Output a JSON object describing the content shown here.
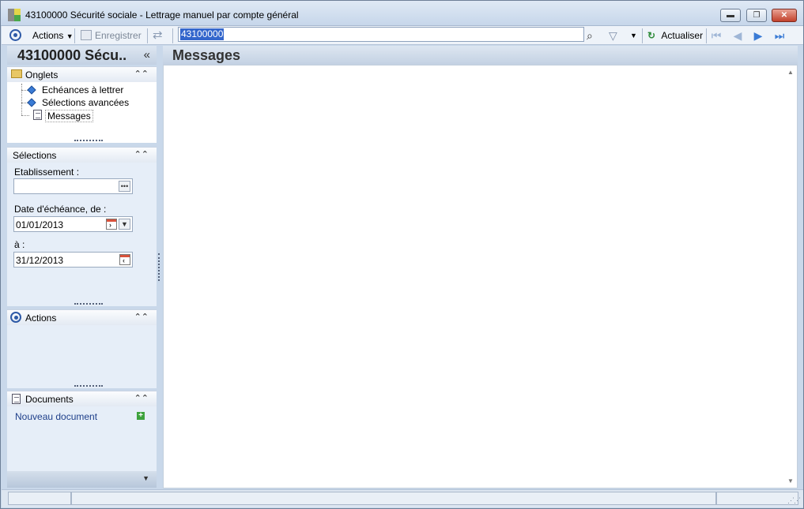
{
  "window": {
    "title": "43100000 Sécurité sociale -  Lettrage manuel par compte général",
    "minimize_label": "▬",
    "restore_label": "❐",
    "close_label": "✕"
  },
  "toolbar": {
    "actions_label": "Actions",
    "save_label": "Enregistrer",
    "search_value": "43100000",
    "refresh_label": "Actualiser"
  },
  "left_panel": {
    "header_title": "43100000 Sécu..",
    "collapse_glyph": "«",
    "onglets": {
      "title": "Onglets",
      "items": [
        {
          "label": "Echéances à lettrer",
          "icon": "diamond-icon"
        },
        {
          "label": "Sélections avancées",
          "icon": "diamond-icon"
        },
        {
          "label": "Messages",
          "icon": "document-icon",
          "selected": true
        }
      ]
    },
    "selections": {
      "title": "Sélections",
      "etablissement_label": "Etablissement :",
      "etablissement_value": "",
      "date_from_label": "Date d'échéance, de :",
      "date_from_value": "01/01/2013",
      "date_to_label": "à :",
      "date_to_value": "31/12/2013"
    },
    "actions": {
      "title": "Actions"
    },
    "documents": {
      "title": "Documents",
      "new_document_label": "Nouveau document"
    }
  },
  "main": {
    "title": "Messages"
  },
  "colors": {
    "accent": "#2e5aa7",
    "panel_bg": "#e6eef8",
    "link": "#1e3f8a"
  }
}
